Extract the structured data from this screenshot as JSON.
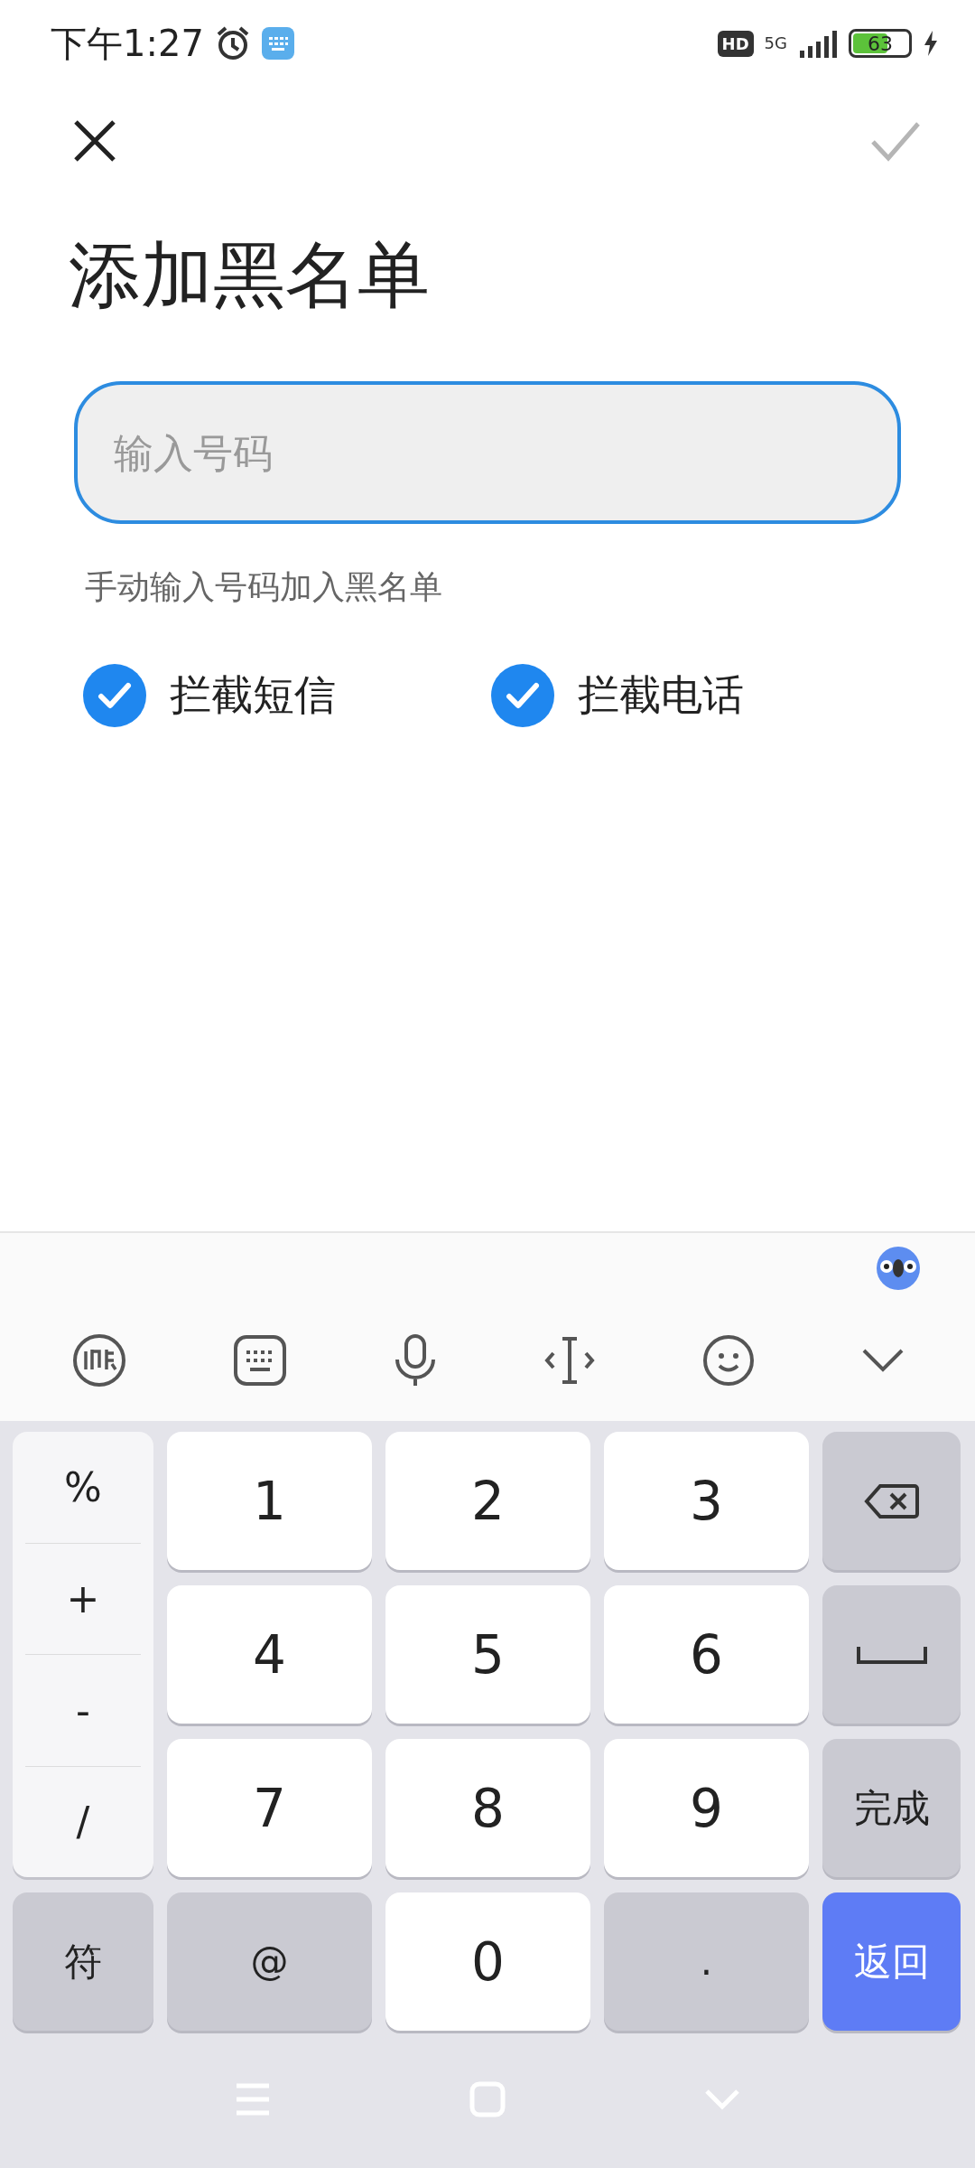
{
  "status_bar": {
    "time": "下午1:27",
    "hd": "HD",
    "network": "5G",
    "battery": "63"
  },
  "header": {
    "confirm_enabled": false
  },
  "title": "添加黑名单",
  "number_field": {
    "placeholder": "输入号码",
    "focused": true
  },
  "hint": "手动输入号码加入黑名单",
  "options": [
    {
      "label": "拦截短信",
      "checked": true
    },
    {
      "label": "拦截电话",
      "checked": true
    }
  ],
  "keyboard": {
    "side_keys": [
      "%",
      "+",
      "-",
      "/"
    ],
    "keys": [
      {
        "kind": "digit",
        "label": "1"
      },
      {
        "kind": "digit",
        "label": "2"
      },
      {
        "kind": "digit",
        "label": "3"
      },
      {
        "kind": "backspace"
      },
      {
        "kind": "digit",
        "label": "4"
      },
      {
        "kind": "digit",
        "label": "5"
      },
      {
        "kind": "digit",
        "label": "6"
      },
      {
        "kind": "space"
      },
      {
        "kind": "digit",
        "label": "7"
      },
      {
        "kind": "digit",
        "label": "8"
      },
      {
        "kind": "digit",
        "label": "9"
      },
      {
        "kind": "function",
        "label": "完成"
      },
      {
        "kind": "function",
        "label": "符"
      },
      {
        "kind": "function",
        "label": "@"
      },
      {
        "kind": "digit",
        "label": "0"
      },
      {
        "kind": "function",
        "label": "."
      },
      {
        "kind": "action",
        "label": "返回"
      }
    ]
  }
}
